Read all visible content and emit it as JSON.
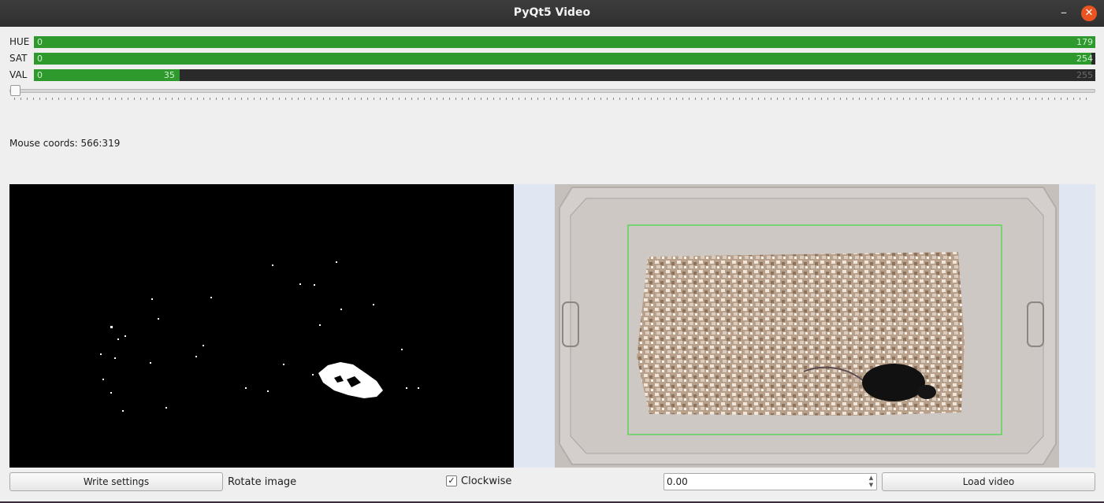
{
  "window": {
    "title": "PyQt5 Video",
    "minimize_glyph": "–",
    "close_glyph": "✕",
    "close_color": "#e95420"
  },
  "ranges": [
    {
      "label": "HUE",
      "min": 0,
      "max": 179,
      "min_text": "0",
      "max_text": "179",
      "full": 179
    },
    {
      "label": "SAT",
      "min": 0,
      "max": 254,
      "min_text": "0",
      "max_text": "254",
      "full": 255
    },
    {
      "label": "VAL",
      "min": 0,
      "max": 35,
      "min_text": "0",
      "max_text": "35",
      "full_text": "255",
      "full": 255
    }
  ],
  "range_fill_color": "#2e9a2e",
  "slider": {
    "value": 0
  },
  "mouse_coords": "Mouse coords: 566:319",
  "controls": {
    "write_settings": "Write settings",
    "rotate_image": "Rotate image",
    "clockwise_label": "Clockwise",
    "clockwise_checked": true,
    "check_glyph": "✓",
    "spin_value": "0.00",
    "load_video": "Load video"
  },
  "colors": {
    "roi_rectangle": "#22dd22",
    "view_background": "#e1e6f3"
  }
}
